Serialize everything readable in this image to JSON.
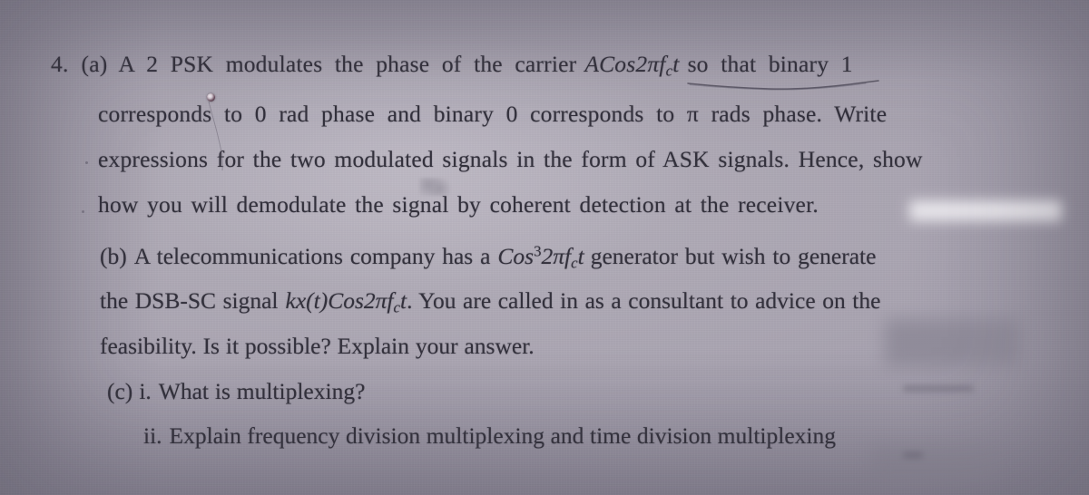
{
  "document": {
    "kind": "exam-question-photo",
    "question_number": "4.",
    "background_color": "#a5a1ad",
    "text_color": "#33313c"
  },
  "lines": {
    "l1": {
      "number": "4.",
      "part": "(a)",
      "before_math": "A 2 PSK modulates the phase of the carrier",
      "math_base": "ACos2πf",
      "math_sub": "c",
      "math_tail": "t",
      "after_math": "so that binary 1"
    },
    "l2": "corresponds to 0 rad phase and binary 0 corresponds to π rads phase. Write",
    "l3": "expressions for the two modulated signals in the form of ASK signals. Hence, show",
    "l4": "how you will demodulate the signal by coherent detection at the receiver.",
    "l5": {
      "part": "(b)",
      "before_math": "A telecommunications company has a",
      "math_base": "Cos",
      "math_sup": "3",
      "math_mid": "2πf",
      "math_sub": "c",
      "math_tail": "t",
      "after_math": "generator but wish to generate"
    },
    "l6": {
      "before_math": "the DSB-SC signal",
      "math_base": "kx(t)Cos2πf",
      "math_sub": "c",
      "math_tail": "t",
      "after_math": ". You are called in as a consultant to advice on the"
    },
    "l7": "feasibility. Is it possible? Explain your answer.",
    "l8": {
      "part": "(c)",
      "roman": "i.",
      "text": "What is multiplexing?"
    },
    "l9": {
      "roman": "ii.",
      "text": "Explain frequency division multiplexing and time division multiplexing"
    }
  },
  "annotations": {
    "underline_target": "ACos2πf_c t",
    "underline_style": "hand-drawn pencil line"
  }
}
